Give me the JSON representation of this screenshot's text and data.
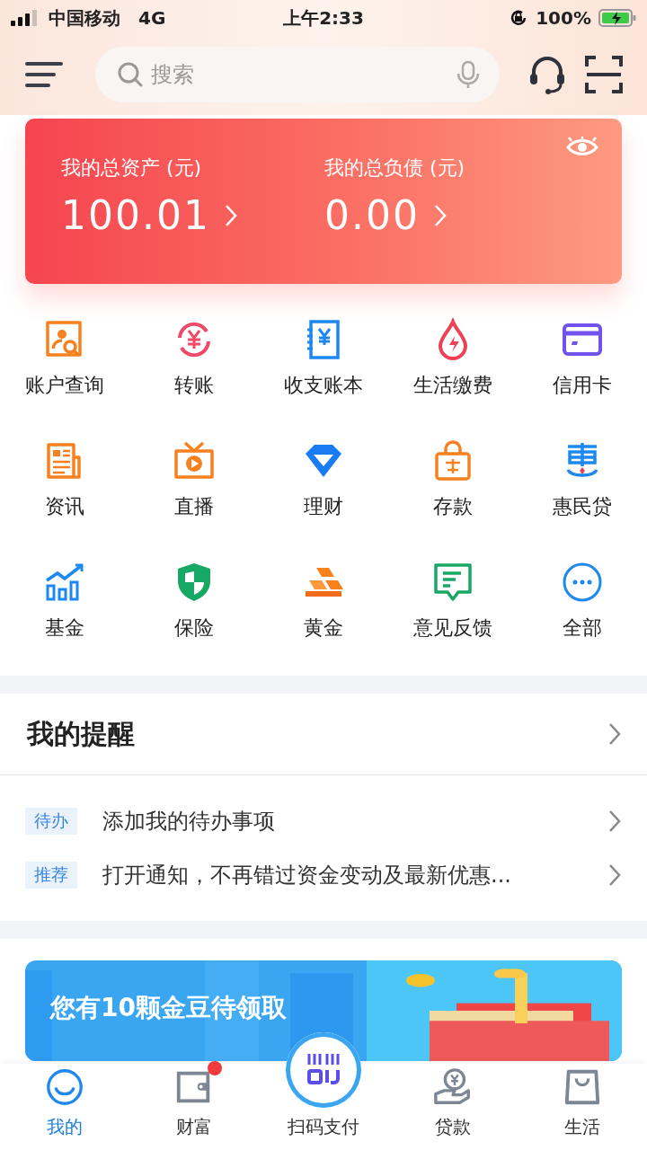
{
  "status_bar": {
    "carrier": "中国移动",
    "network": "4G",
    "time": "上午2:33",
    "battery": "100%"
  },
  "header": {
    "search": {
      "placeholder": "搜索"
    }
  },
  "asset_card": {
    "items": [
      {
        "label": "我的总资产 (元)",
        "value": "100.01"
      },
      {
        "label": "我的总负债 (元)",
        "value": "0.00"
      }
    ]
  },
  "services": [
    {
      "label": "账户查询",
      "kind": "account"
    },
    {
      "label": "转账",
      "kind": "transfer"
    },
    {
      "label": "收支账本",
      "kind": "ledger"
    },
    {
      "label": "生活缴费",
      "kind": "utility"
    },
    {
      "label": "信用卡",
      "kind": "card"
    },
    {
      "label": "资讯",
      "kind": "news"
    },
    {
      "label": "直播",
      "kind": "live"
    },
    {
      "label": "理财",
      "kind": "diamond"
    },
    {
      "label": "存款",
      "kind": "deposit"
    },
    {
      "label": "惠民贷",
      "kind": "loan"
    },
    {
      "label": "基金",
      "kind": "fund"
    },
    {
      "label": "保险",
      "kind": "shield"
    },
    {
      "label": "黄金",
      "kind": "gold"
    },
    {
      "label": "意见反馈",
      "kind": "feedback"
    },
    {
      "label": "全部",
      "kind": "more"
    }
  ],
  "reminders": {
    "title": "我的提醒",
    "items": [
      {
        "tag": "待办",
        "text": "添加我的待办事项"
      },
      {
        "tag": "推荐",
        "text": "打开通知，不再错过资金变动及最新优惠..."
      }
    ]
  },
  "promo_banner": {
    "title": "您有10颗金豆待领取"
  },
  "tab_bar": [
    {
      "label": "我的",
      "kind": "smile",
      "selected": true,
      "badge": false
    },
    {
      "label": "财富",
      "kind": "wallet",
      "selected": false,
      "badge": true
    },
    {
      "label": "扫码支付",
      "kind": "scan",
      "selected": false,
      "badge": false
    },
    {
      "label": "贷款",
      "kind": "yenhand",
      "selected": false,
      "badge": false
    },
    {
      "label": "生活",
      "kind": "bag",
      "selected": false,
      "badge": false
    }
  ]
}
